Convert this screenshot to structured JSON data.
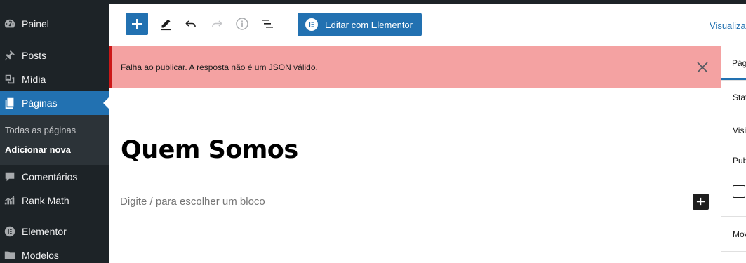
{
  "sidebar": {
    "items": [
      {
        "label": "Painel",
        "icon": "dashboard-icon"
      },
      {
        "label": "Posts",
        "icon": "pin-icon"
      },
      {
        "label": "Mídia",
        "icon": "media-icon"
      },
      {
        "label": "Páginas",
        "icon": "pages-icon",
        "active": true
      },
      {
        "label": "Comentários",
        "icon": "comment-icon"
      },
      {
        "label": "Rank Math",
        "icon": "rank-math-icon"
      },
      {
        "label": "Elementor",
        "icon": "elementor-icon"
      },
      {
        "label": "Modelos",
        "icon": "folder-icon"
      }
    ],
    "submenu": [
      {
        "label": "Todas as páginas"
      },
      {
        "label": "Adicionar nova",
        "current": true
      }
    ]
  },
  "toolbar": {
    "elementor_label": "Editar com Elementor",
    "preview_label": "Visualizar"
  },
  "notice": {
    "text": "Falha ao publicar. A resposta não é um JSON válido."
  },
  "editor": {
    "title": "Quem Somos",
    "placeholder": "Digite / para escolher um bloco"
  },
  "panel": {
    "tab": "Página",
    "labels": [
      "Status",
      "Visibilidade",
      "Publicar",
      "Mover"
    ]
  },
  "colors": {
    "sidebar_bg": "#1d2327",
    "accent": "#2271b1",
    "notice_bg": "#f4a2a2",
    "notice_border": "#cc1818"
  }
}
